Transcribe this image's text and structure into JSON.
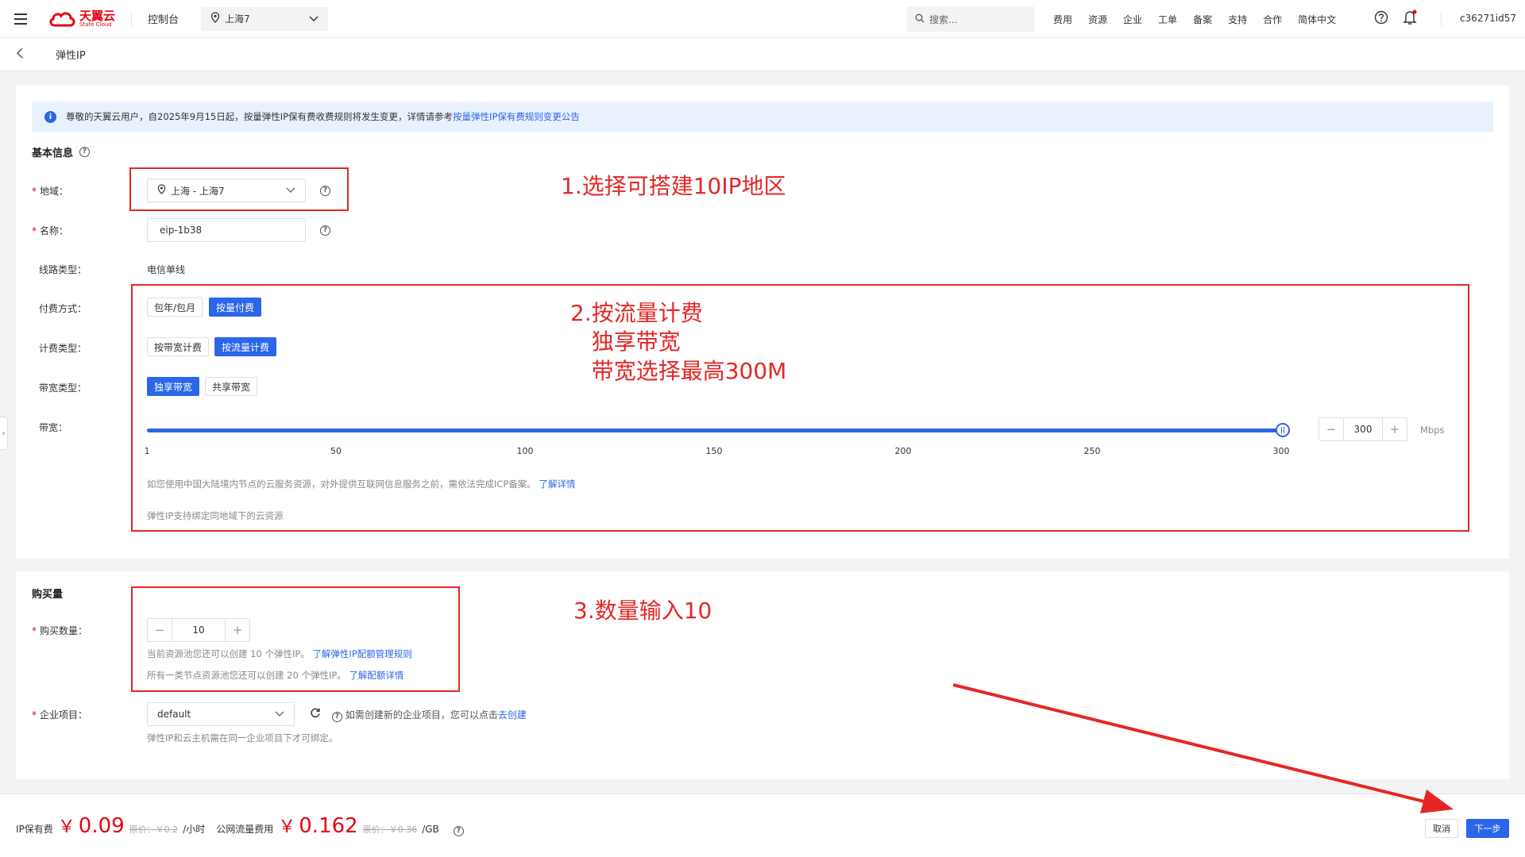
{
  "topbar": {
    "logo_cn": "天翼云",
    "logo_en": "State Cloud",
    "console": "控制台",
    "region": "上海7",
    "search_placeholder": "搜索...",
    "nav": [
      "费用",
      "资源",
      "企业",
      "工单",
      "备案",
      "支持",
      "合作",
      "简体中文"
    ],
    "user": "c36271id57"
  },
  "breadcrumb": {
    "title": "弹性IP"
  },
  "notice": {
    "text": "尊敬的天翼云用户，自2025年9月15日起，按量弹性IP保有费收费规则将发生变更，详情请参考",
    "link": "按量弹性IP保有费规则变更公告"
  },
  "basic": {
    "title": "基本信息",
    "region_label": "地域：",
    "region_value": "上海 - 上海7",
    "name_label": "名称：",
    "name_value": "eip-1b38",
    "line_label": "线路类型：",
    "line_value": "电信单线",
    "pay_label": "付费方式：",
    "pay_opts": [
      "包年/包月",
      "按量付费"
    ],
    "billing_label": "计费类型：",
    "billing_opts": [
      "按带宽计费",
      "按流量计费"
    ],
    "bw_type_label": "带宽类型：",
    "bw_type_opts": [
      "独享带宽",
      "共享带宽"
    ],
    "bw_label": "带宽：",
    "bw_value": "300",
    "bw_fraction": 1.0,
    "bw_unit": "Mbps",
    "ticks": [
      "1",
      "50",
      "100",
      "150",
      "200",
      "250",
      "300"
    ],
    "icp_text": "如您使用中国大陆境内节点的云服务资源，对外提供互联网信息服务之前，需依法完成ICP备案。",
    "icp_link": "了解详情",
    "bind_text": "弹性IP支持绑定同地域下的云资源"
  },
  "purchase": {
    "title": "购买量",
    "qty_label": "购买数量：",
    "qty_value": "10",
    "hint1": "当前资源池您还可以创建 10 个弹性IP。",
    "hint1_link": "了解弹性IP配额管理规则",
    "hint2": "所有一类节点资源池您还可以创建 20 个弹性IP。",
    "hint2_link": "了解配额详情",
    "project_label": "企业项目：",
    "project_value": "default",
    "project_hint": "如需创建新的企业项目，您可以点击",
    "project_link": "去创建",
    "project_note": "弹性IP和云主机需在同一企业项目下才可绑定。"
  },
  "annotations": {
    "a1": "1.选择可搭建10IP地区",
    "a2": "2.按流量计费\n   独享带宽\n   带宽选择最高300M",
    "a3": "3.数量输入10"
  },
  "footer": {
    "ip_fee_label": "IP保有费",
    "ip_fee_value": "0.09",
    "ip_fee_orig": "原价：￥0.2",
    "ip_fee_unit": "/小时",
    "traffic_label": "公网流量费用",
    "traffic_value": "0.162",
    "traffic_orig": "原价：￥0.36",
    "traffic_unit": "/GB",
    "currency": "￥",
    "cancel": "取消",
    "next": "下一步"
  },
  "colors": {
    "accent": "#2b66e9",
    "annotation": "#e62626",
    "price": "#e60012"
  }
}
